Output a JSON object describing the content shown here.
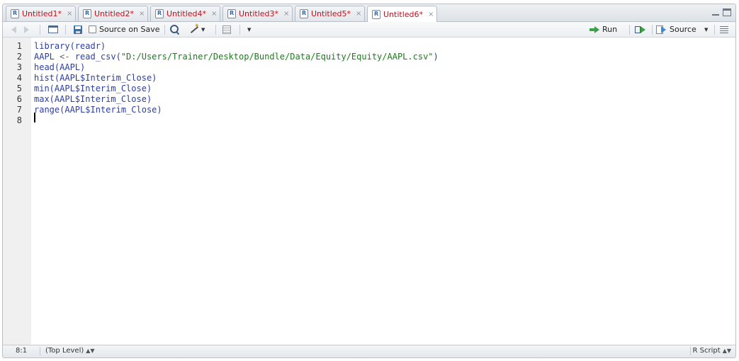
{
  "tabs": [
    {
      "label": "Untitled1*",
      "active": false
    },
    {
      "label": "Untitled2*",
      "active": false
    },
    {
      "label": "Untitled4*",
      "active": false
    },
    {
      "label": "Untitled3*",
      "active": false
    },
    {
      "label": "Untitled5*",
      "active": false
    },
    {
      "label": "Untitled6*",
      "active": true
    }
  ],
  "tab_close_glyph": "×",
  "toolbar": {
    "source_on_save": "Source on Save",
    "run": "Run",
    "source": "Source"
  },
  "editor": {
    "line_numbers": [
      "1",
      "2",
      "3",
      "4",
      "5",
      "6",
      "7",
      "8"
    ],
    "lines": [
      "library(readr)",
      "AAPL <- read_csv(\"D:/Users/Trainer/Desktop/Bundle/Data/Equity/Equity/AAPL.csv\")",
      "head(AAPL)",
      "hist(AAPL$Interim_Close)",
      "min(AAPL$Interim_Close)",
      "max(AAPL$Interim_Close)",
      "range(AAPL$Interim_Close)",
      ""
    ],
    "path_string": "\"D:/Users/Trainer/Desktop/Bundle/Data/Equity/Equity/AAPL.csv\""
  },
  "status": {
    "position": "8:1",
    "scope": "(Top Level)",
    "file_type": "R Script"
  },
  "colors": {
    "tab_label": "#c0121e",
    "keyword": "#2d3e9f",
    "string": "#1a7d1a",
    "gutter": "#f0f0f0"
  },
  "icons": [
    "back-arrow-icon",
    "forward-arrow-icon",
    "show-in-window-icon",
    "save-icon",
    "search-icon",
    "code-tools-wand-icon",
    "compile-report-icon",
    "run-icon",
    "rerun-icon",
    "source-icon",
    "document-outline-icon"
  ]
}
